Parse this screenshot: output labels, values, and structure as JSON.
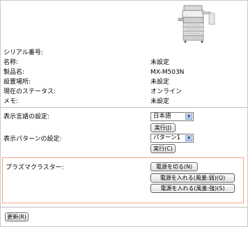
{
  "device": {
    "serial_label": "シリアル番号:",
    "rows": [
      {
        "label": "名称:",
        "value": "未設定"
      },
      {
        "label": "製品名:",
        "value": "MX-M503N"
      },
      {
        "label": "設置場所:",
        "value": "未設定"
      },
      {
        "label": "現在のステータス:",
        "value": "オンライン"
      },
      {
        "label": "メモ:",
        "value": "未設定"
      }
    ]
  },
  "language": {
    "label": "表示言語の設定:",
    "selected": "日本語",
    "execute": "実行(J)"
  },
  "pattern": {
    "label": "表示パターンの設定:",
    "selected": "パターン1",
    "execute": "実行(C)"
  },
  "plasmacluster": {
    "label": "プラズマクラスター:",
    "power_off": "電源を切る(N)",
    "power_on_weak": "電源を入れる(風量:弱)(Q)",
    "power_on_strong": "電源を入れる(風量:強)(S)"
  },
  "footer": {
    "refresh": "更新(R)"
  },
  "colors": {
    "border_highlight": "#f0a582",
    "divider": "#bdbdbd"
  }
}
